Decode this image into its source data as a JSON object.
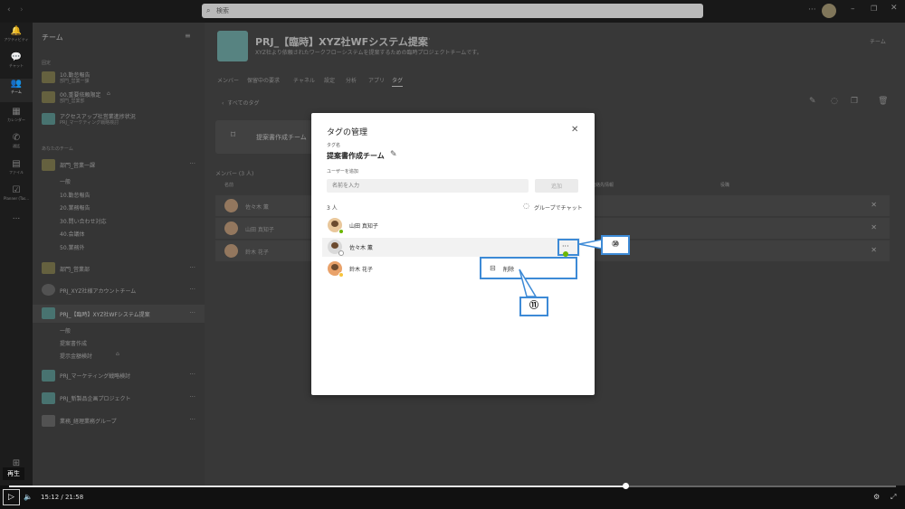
{
  "titlebar": {
    "search_placeholder": "検索"
  },
  "rail": [
    {
      "label": "アクティビティ",
      "icon": "bell-icon"
    },
    {
      "label": "チャット",
      "icon": "chat-icon"
    },
    {
      "label": "チーム",
      "icon": "teams-icon"
    },
    {
      "label": "カレンダー",
      "icon": "calendar-icon"
    },
    {
      "label": "通話",
      "icon": "phone-icon"
    },
    {
      "label": "ファイル",
      "icon": "file-icon"
    },
    {
      "label": "Planner (Tas...",
      "icon": "planner-icon"
    },
    {
      "label": "...",
      "icon": "more-icon"
    }
  ],
  "sidebar": {
    "title": "チーム",
    "pinned_header": "固定",
    "pinned": [
      {
        "name": "10.勤怠報告",
        "sub": "部門_営業一課"
      },
      {
        "name": "00.重要依頼限定",
        "sub": "部門_営業部"
      },
      {
        "name": "アクセスアップ社営業進捗状況",
        "sub": "PRJ_マーケティング戦略検討"
      }
    ],
    "your_teams_header": "あなたのチーム",
    "team1": {
      "name": "部門_営業一課",
      "channels": [
        "一般",
        "10.勤怠報告",
        "20.業務報告",
        "30.問い合わせ対応",
        "40.会議体",
        "50.業務外"
      ]
    },
    "team2": {
      "name": "部門_営業部"
    },
    "team3": {
      "name": "PRJ_XYZ社様アカウントチーム"
    },
    "team4": {
      "name": "PRJ_【臨時】XYZ社WFシステム提案",
      "channels": [
        "一般",
        "提案書作成",
        "提示金額検討"
      ]
    },
    "team5": {
      "name": "PRJ_マーケティング戦略検討"
    },
    "team6": {
      "name": "PRJ_新製品企画プロジェクト"
    },
    "team7": {
      "name": "業務_経理業務グループ"
    }
  },
  "main": {
    "team_title": "PRJ_【臨時】XYZ社WFシステム提案",
    "team_desc": "XYZ社より依頼されたワークフローシステムを提案するための臨時プロジェクトチームです。",
    "team_btn": "チーム",
    "tabs": [
      "メンバー",
      "保留中の要求",
      "チャネル",
      "設定",
      "分析",
      "アプリ",
      "タグ"
    ],
    "back_link": "すべてのタグ",
    "tag_card": "提案書作成チーム",
    "members_header": "メンバー (3 人)",
    "col_name": "名前",
    "col_contact": "連絡先情報",
    "col_role": "役職",
    "members": [
      "佐々木 薫",
      "山田 真知子",
      "鈴木 花子"
    ]
  },
  "dialog": {
    "title": "タグの管理",
    "tag_name_label": "タグ名",
    "tag_name": "提案書作成チーム",
    "add_user_label": "ユーザーを追加",
    "name_placeholder": "名前を入力",
    "add_button": "追加",
    "count": "3 人",
    "group_chat": "グループでチャット",
    "members": [
      {
        "name": "山田 真知子",
        "status": "available"
      },
      {
        "name": "佐々木 薫",
        "status": "offline"
      },
      {
        "name": "鈴木 花子",
        "status": "away"
      }
    ]
  },
  "context_menu": {
    "delete": "削除"
  },
  "callouts": [
    "⑩",
    "⑪"
  ],
  "player": {
    "tooltip": "再生",
    "time": "15:12 / 21:58",
    "progress_fraction": 0.695
  },
  "colors": {
    "accent": "#3d8ad6",
    "available": "#6bb700",
    "away": "#f8c43c"
  }
}
